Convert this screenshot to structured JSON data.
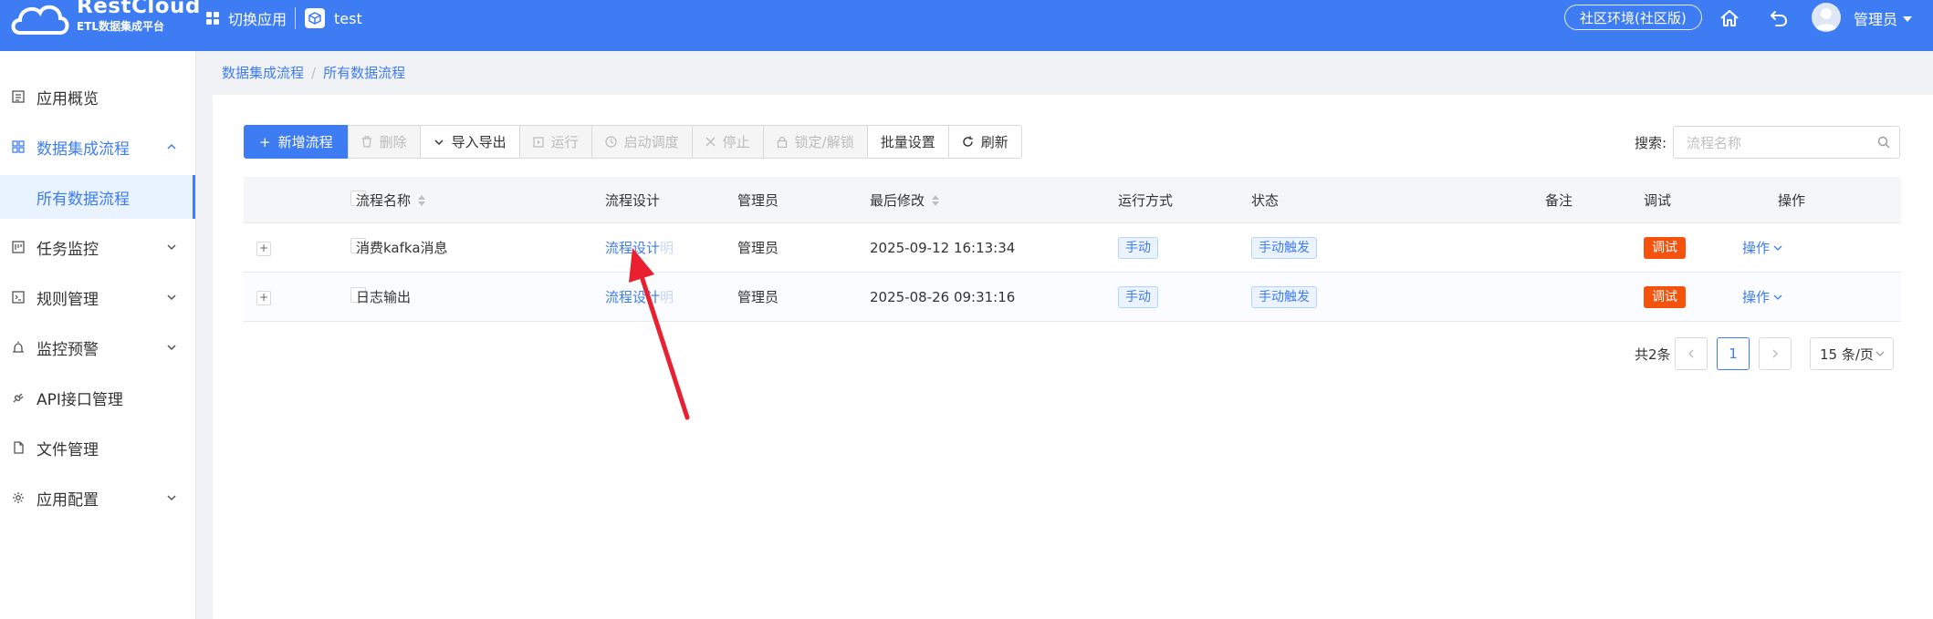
{
  "header": {
    "logo_name": "RestCloud",
    "logo_subtitle": "ETL数据集成平台",
    "switch_app": "切换应用",
    "current_app": "test",
    "env_label": "社区环境(社区版)",
    "user_name": "管理员",
    "colors": {
      "bar": "#3e7cf4"
    },
    "icons": [
      "apps-grid-icon",
      "app-cube-icon",
      "home-icon",
      "back-arrow-icon",
      "user-avatar-icon"
    ]
  },
  "sidebar": {
    "items": [
      {
        "label": "应用概览",
        "icon": "document-icon"
      },
      {
        "label": "数据集成流程",
        "icon": "grid-icon",
        "expanded": true
      },
      {
        "label": "所有数据流程",
        "selected": true
      },
      {
        "label": "任务监控",
        "icon": "monitor-board-icon"
      },
      {
        "label": "规则管理",
        "icon": "terminal-icon"
      },
      {
        "label": "监控预警",
        "icon": "alarm-icon"
      },
      {
        "label": "API接口管理",
        "icon": "plug-icon"
      },
      {
        "label": "文件管理",
        "icon": "file-icon"
      },
      {
        "label": "应用配置",
        "icon": "gear-icon"
      }
    ]
  },
  "breadcrumb": {
    "items": [
      "数据集成流程",
      "所有数据流程"
    ],
    "separator": "/"
  },
  "toolbar": {
    "new_flow": "新增流程",
    "delete": "删除",
    "import_export": "导入导出",
    "run": "运行",
    "schedule": "启动调度",
    "stop": "停止",
    "lock": "锁定/解锁",
    "batch_settings": "批量设置",
    "refresh": "刷新"
  },
  "search": {
    "label": "搜索:",
    "placeholder": "流程名称"
  },
  "table": {
    "columns": [
      "流程名称",
      "流程设计",
      "管理员",
      "最后修改",
      "运行方式",
      "状态",
      "备注",
      "调试",
      "操作"
    ],
    "rows": [
      {
        "name": "消费kafka消息",
        "design": "流程设计",
        "design_extra": "明",
        "admin": "管理员",
        "modified": "2025-09-12 16:13:34",
        "run_mode": "手动",
        "status": "手动触发",
        "note": "",
        "debug": "调试",
        "action": "操作"
      },
      {
        "name": "日志输出",
        "design": "流程设计",
        "design_extra": "明",
        "admin": "管理员",
        "modified": "2025-08-26 09:31:16",
        "run_mode": "手动",
        "status": "手动触发",
        "note": "",
        "debug": "调试",
        "action": "操作"
      }
    ]
  },
  "pagination": {
    "total": "共2条",
    "current_page": "1",
    "page_size": "15 条/页"
  },
  "annotation": {
    "color": "#e8202f"
  }
}
